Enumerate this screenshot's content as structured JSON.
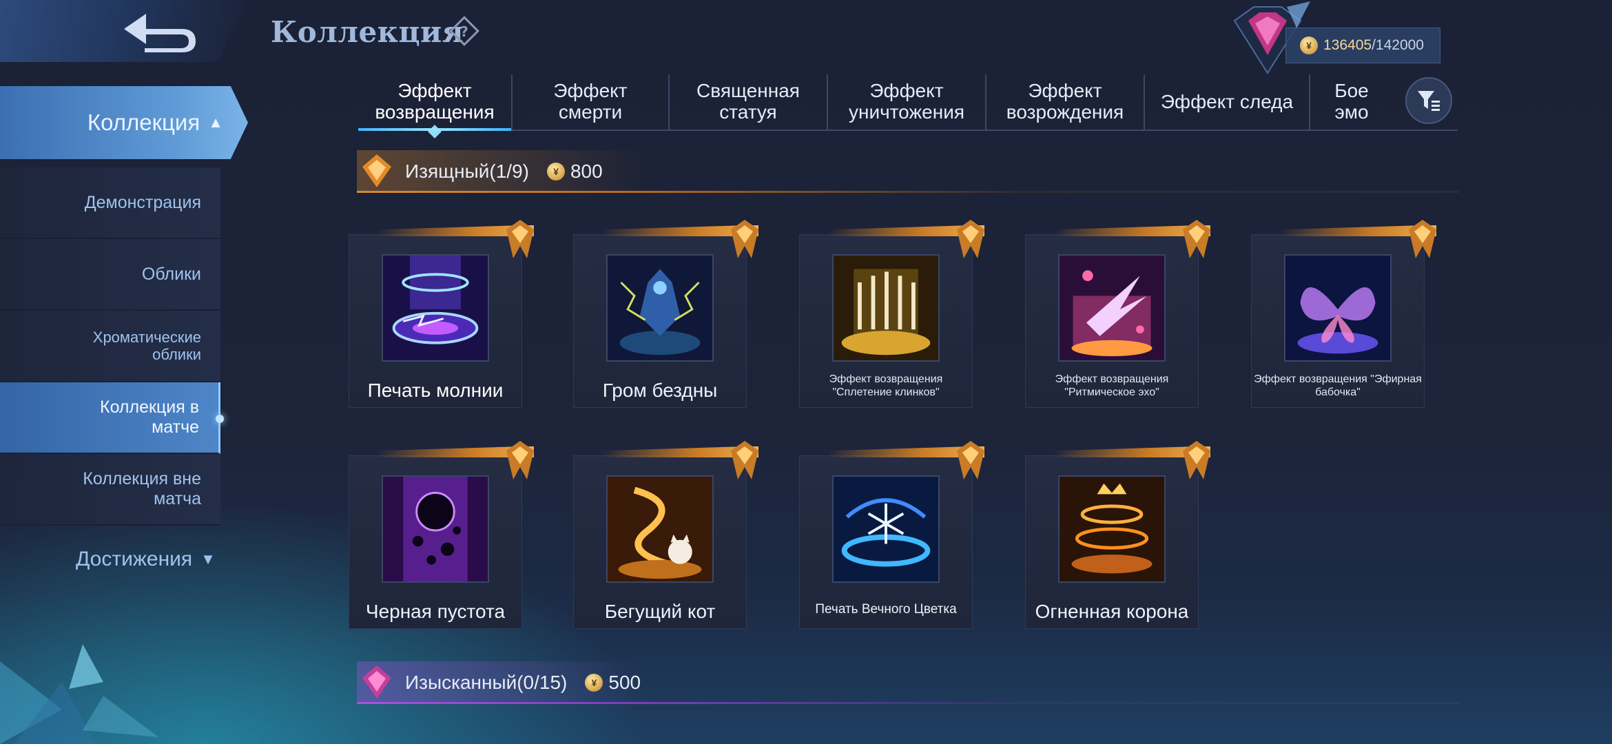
{
  "header": {
    "title": "Коллекция",
    "currency_current": "136405",
    "currency_max": "/142000"
  },
  "sidebar": {
    "main_label": "Коллекция",
    "items": [
      {
        "label": "Демонстрация"
      },
      {
        "label": "Облики"
      },
      {
        "label": "Хроматические облики"
      },
      {
        "label": "Коллекция в матче"
      },
      {
        "label": "Коллекция вне матча"
      }
    ],
    "achievements_label": "Достижения"
  },
  "tabs": [
    {
      "label": "Эффект возвращения"
    },
    {
      "label": "Эффект смерти"
    },
    {
      "label": "Священная статуя"
    },
    {
      "label": "Эффект уничтожения"
    },
    {
      "label": "Эффект возрождения"
    },
    {
      "label": "Эффект следа"
    },
    {
      "label": "Бое эмо"
    }
  ],
  "sections": [
    {
      "title": "Изящный(1/9)",
      "price": "800",
      "items": [
        {
          "name": "Печать молнии"
        },
        {
          "name": "Гром бездны"
        },
        {
          "name": "Эффект возвращения \"Сплетение клинков\""
        },
        {
          "name": "Эффект возвращения \"Ритмическое эхо\""
        },
        {
          "name": "Эффект возвращения \"Эфирная бабочка\""
        },
        {
          "name": "Черная пустота"
        },
        {
          "name": "Бегущий кот"
        },
        {
          "name": "Печать Вечного Цветка"
        },
        {
          "name": "Огненная корона"
        }
      ]
    },
    {
      "title": "Изысканный(0/15)",
      "price": "500"
    }
  ],
  "colors": {
    "accent_blue": "#5f9ad6",
    "orange_tier": "#d98a2b",
    "purple_tier": "#b04fe0",
    "gold": "#f3d99a"
  }
}
